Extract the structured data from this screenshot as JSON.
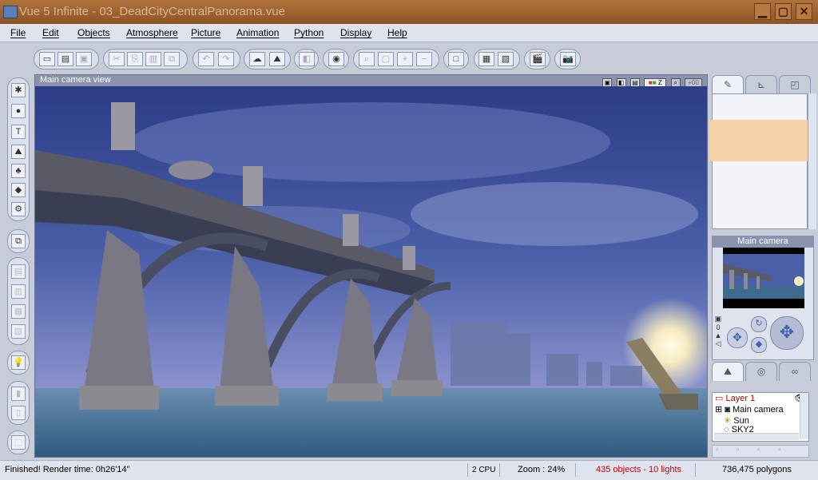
{
  "window": {
    "title": "Vue 5 Infinite - 03_DeadCityCentralPanorama.vue",
    "controls": [
      "minimize",
      "maximize",
      "close"
    ]
  },
  "menu": [
    "File",
    "Edit",
    "Objects",
    "Atmosphere",
    "Picture",
    "Animation",
    "Python",
    "Display",
    "Help"
  ],
  "toolbar": {
    "icons": [
      "new-icon",
      "open-icon",
      "save-icon",
      "cut-icon",
      "copy-icon",
      "paste-icon",
      "duplicate-icon",
      "undo-icon",
      "redo-icon",
      "atmosphere-icon",
      "terrain-icon",
      "material-icon",
      "view-icon",
      "zoom-fit-icon",
      "zoom-region-icon",
      "zoom-in-icon",
      "zoom-out-icon",
      "frame-icon",
      "render-area-icon",
      "render-settings-icon",
      "animation-icon",
      "render-icon"
    ]
  },
  "left_tools": [
    "select-icon",
    "sphere-icon",
    "text-icon",
    "terrain-icon",
    "plant-icon",
    "rock-icon",
    "settings-icon",
    "group-icon",
    "render-icon",
    "light-icon"
  ],
  "viewport": {
    "label": "Main camera view",
    "header_icons": [
      "render-icon",
      "options-icon",
      "save-icon"
    ],
    "color_channels": [
      "Color",
      "Z"
    ],
    "zoom_indicator": "+00"
  },
  "right_panel": {
    "top_tabs": [
      "paint-icon",
      "ruler-icon",
      "camera-icon"
    ],
    "preview_color": "#f5d2a6",
    "camera_label": "Main camera",
    "side_counter": "0",
    "layer_tabs": [
      "objects-icon",
      "materials-icon",
      "links-icon"
    ],
    "layers": [
      {
        "name": "Layer 1",
        "color": "#a00000"
      },
      {
        "name": "Main camera",
        "color": "#000"
      },
      {
        "name": "Sun",
        "color": "#000"
      },
      {
        "name": "SKY2",
        "color": "#000"
      }
    ]
  },
  "status": {
    "message": "Finished! Render time: 0h26'14\"",
    "cpu": "2 CPU",
    "zoom": "Zoom : 24%",
    "objects": "435 objects - 10 lights",
    "objects_color": "#c00000",
    "polygons": "736,475 polygons"
  }
}
